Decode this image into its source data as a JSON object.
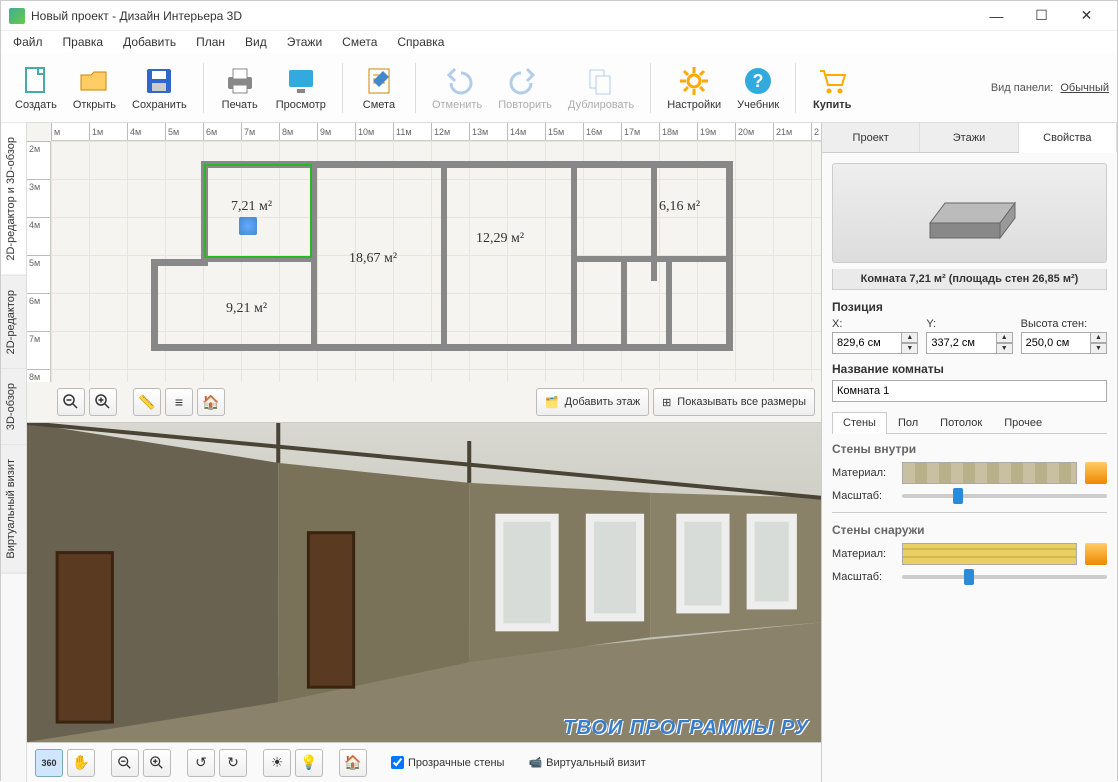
{
  "titlebar": {
    "title": "Новый проект - Дизайн Интерьера 3D"
  },
  "menu": [
    "Файл",
    "Правка",
    "Добавить",
    "План",
    "Вид",
    "Этажи",
    "Смета",
    "Справка"
  ],
  "toolbar": {
    "create": "Создать",
    "open": "Открыть",
    "save": "Сохранить",
    "print": "Печать",
    "preview": "Просмотр",
    "estimate": "Смета",
    "undo": "Отменить",
    "redo": "Повторить",
    "duplicate": "Дублировать",
    "settings": "Настройки",
    "tutorial": "Учебник",
    "buy": "Купить",
    "view_panel_label": "Вид панели:",
    "view_panel_value": "Обычный"
  },
  "side_tabs": {
    "editor_3d": "2D-редактор и 3D-обзор",
    "editor_2d": "2D-редактор",
    "view_3d": "3D-обзор",
    "virtual": "Виртуальный визит"
  },
  "ruler_h": [
    "м",
    "1м",
    "4м",
    "5м",
    "6м",
    "7м",
    "8м",
    "9м",
    "10м",
    "11м",
    "12м",
    "13м",
    "14м",
    "15м",
    "16м",
    "17м",
    "18м",
    "19м",
    "20м",
    "21м",
    "2"
  ],
  "ruler_v": [
    "2м",
    "3м",
    "4м",
    "5м",
    "6м",
    "7м",
    "8м"
  ],
  "rooms": {
    "r1": "7,21 м²",
    "r2": "18,67 м²",
    "r3": "12,29 м²",
    "r4": "6,16 м²",
    "r5": "9,21 м²"
  },
  "plan_toolbar": {
    "add_floor": "Добавить этаж",
    "show_dims": "Показывать все размеры"
  },
  "bottom": {
    "transparent_walls": "Прозрачные стены",
    "virtual_visit": "Виртуальный визит"
  },
  "right": {
    "tabs": {
      "project": "Проект",
      "floors": "Этажи",
      "props": "Свойства"
    },
    "room_info": "Комната 7,21 м²  (площадь стен 26,85 м²)",
    "position_label": "Позиция",
    "x_label": "X:",
    "y_label": "Y:",
    "wall_h_label": "Высота стен:",
    "x_val": "829,6 см",
    "y_val": "337,2 см",
    "wall_h_val": "250,0 см",
    "room_name_label": "Название комнаты",
    "room_name_val": "Комната 1",
    "sub_tabs": {
      "walls": "Стены",
      "floor": "Пол",
      "ceiling": "Потолок",
      "other": "Прочее"
    },
    "walls_inside": "Стены внутри",
    "walls_outside": "Стены снаружи",
    "material": "Материал:",
    "scale": "Масштаб:"
  },
  "watermark": "ТВОИ ПРОГРАММЫ РУ"
}
